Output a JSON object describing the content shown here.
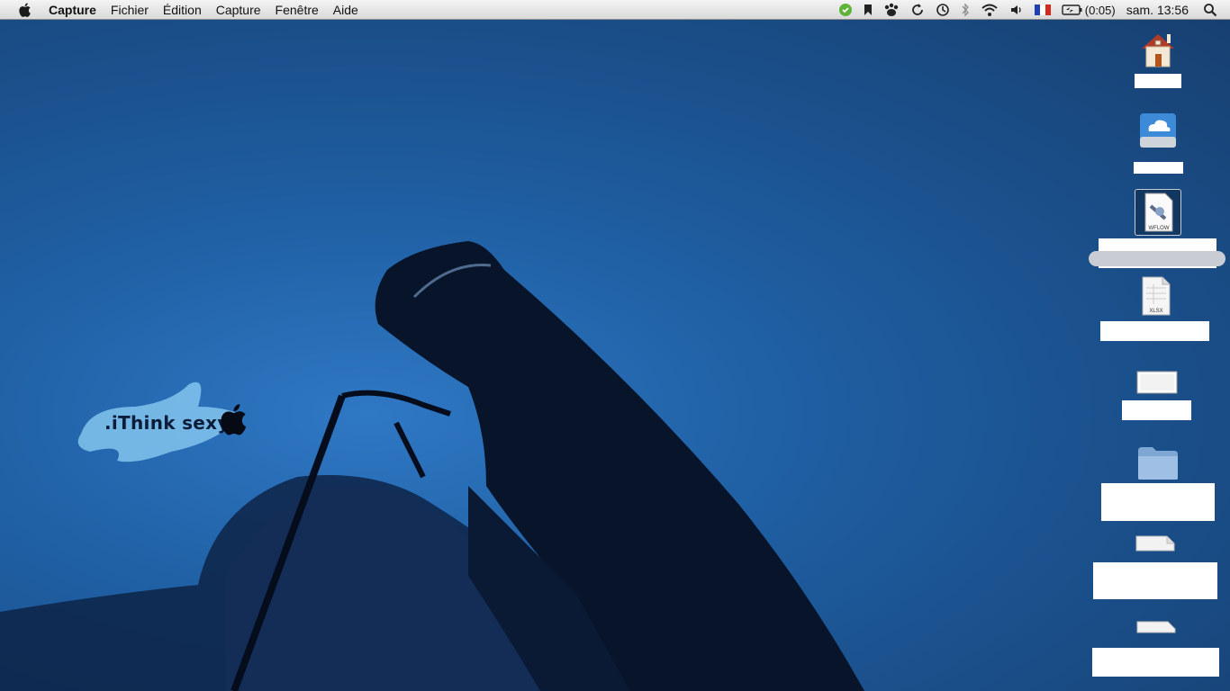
{
  "menubar": {
    "app_name": "Capture",
    "menus": [
      "Fichier",
      "Édition",
      "Capture",
      "Fenêtre",
      "Aide"
    ],
    "status_icons": [
      "evernote-icon",
      "bookmark-icon",
      "paw-icon",
      "sync-icon",
      "time-machine-icon",
      "bluetooth-icon",
      "wifi-icon",
      "volume-icon",
      "french-flag-icon",
      "battery-icon"
    ],
    "battery_text": "(0:05)",
    "clock": "sam. 13:56"
  },
  "wallpaper": {
    "logo_text": ".iThink sexy"
  },
  "desktop_icons": [
    {
      "name": "home-folder-icon",
      "badge": ""
    },
    {
      "name": "icloud-drive-icon",
      "badge": ""
    },
    {
      "name": "workflow-file-icon",
      "badge": "WFLOW"
    },
    {
      "name": "xlsx-file-icon",
      "badge": "XLSX"
    },
    {
      "name": "image-file-icon",
      "badge": ""
    },
    {
      "name": "folder-icon",
      "badge": ""
    },
    {
      "name": "document-file-icon",
      "badge": ""
    },
    {
      "name": "document-file-icon-2",
      "badge": ""
    }
  ],
  "colors": {
    "wallpaper_blue": "#1f5fa3",
    "silhouette": "#0b1a33",
    "logo_swoosh": "#8fd0f5"
  }
}
